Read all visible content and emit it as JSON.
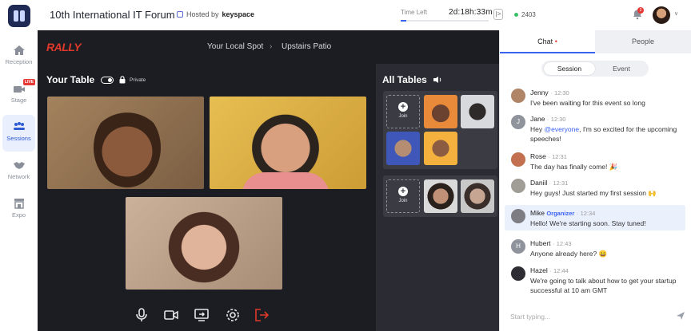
{
  "header": {
    "event_title": "10th International IT Forum",
    "hosted_by_prefix": "Hosted by",
    "host_name": "keyspace",
    "time_left_label": "Time Left",
    "time_left_value": "2d:18h:33m",
    "time_left_fraction": 0.06,
    "collapse_label": "|>",
    "online_count": "2403",
    "notifications_count": "2",
    "avatar_caret": "∨"
  },
  "sidebar": {
    "items": [
      {
        "label": "Reception",
        "icon": "home-icon"
      },
      {
        "label": "Stage",
        "icon": "video-camera-icon",
        "badge": "LIVE"
      },
      {
        "label": "Sessions",
        "icon": "people-table-icon",
        "active": true
      },
      {
        "label": "Network",
        "icon": "handshake-icon"
      },
      {
        "label": "Expo",
        "icon": "store-icon"
      }
    ]
  },
  "stage": {
    "brand": "RALLY",
    "breadcrumb": [
      "Your Local Spot",
      "Upstairs Patio"
    ],
    "breadcrumb_separator": "›",
    "your_table_title": "Your Table",
    "private_label": "Private",
    "controls": [
      "microphone-icon",
      "camera-icon",
      "screen-share-icon",
      "settings-icon",
      "leave-icon"
    ]
  },
  "all_tables": {
    "title": "All Tables",
    "join_label": "Join",
    "join_plus": "+"
  },
  "chat": {
    "tabs": [
      {
        "label": "Chat",
        "dot": "•"
      },
      {
        "label": "People"
      }
    ],
    "segments": [
      "Session",
      "Event"
    ],
    "messages": [
      {
        "name": "Jenny",
        "time": "12:30",
        "text": "I've been waiting for this event so long",
        "avatar_color": "#b08466"
      },
      {
        "name": "Jane",
        "time": "12:30",
        "initial": "J",
        "text_before": "Hey ",
        "mention": "@everyone",
        "text_after": ", I'm so excited for the upcoming speeches!",
        "avatar_color": "#8e939c"
      },
      {
        "name": "Rose",
        "time": "12:31",
        "text": "The day has finally come! 🎉",
        "avatar_color": "#c2704f"
      },
      {
        "name": "Daniil",
        "time": "12:31",
        "text": "Hey guys! Just started my first session 🙌",
        "avatar_color": "#a09d96"
      },
      {
        "name": "Mike",
        "role": "Organizer",
        "time": "12:34",
        "text": "Hello! We're starting soon. Stay tuned!",
        "avatar_color": "#7d7d83"
      },
      {
        "name": "Hubert",
        "time": "12:43",
        "initial": "H",
        "text": "Anyone already here? 😀",
        "avatar_color": "#8e939c"
      },
      {
        "name": "Hazel",
        "time": "12:44",
        "text": "We're going to talk about how to get your startup successful at 10 am GMT",
        "avatar_color": "#2d2d33"
      }
    ],
    "time_separator": "·",
    "input_placeholder": "Start typing..."
  }
}
